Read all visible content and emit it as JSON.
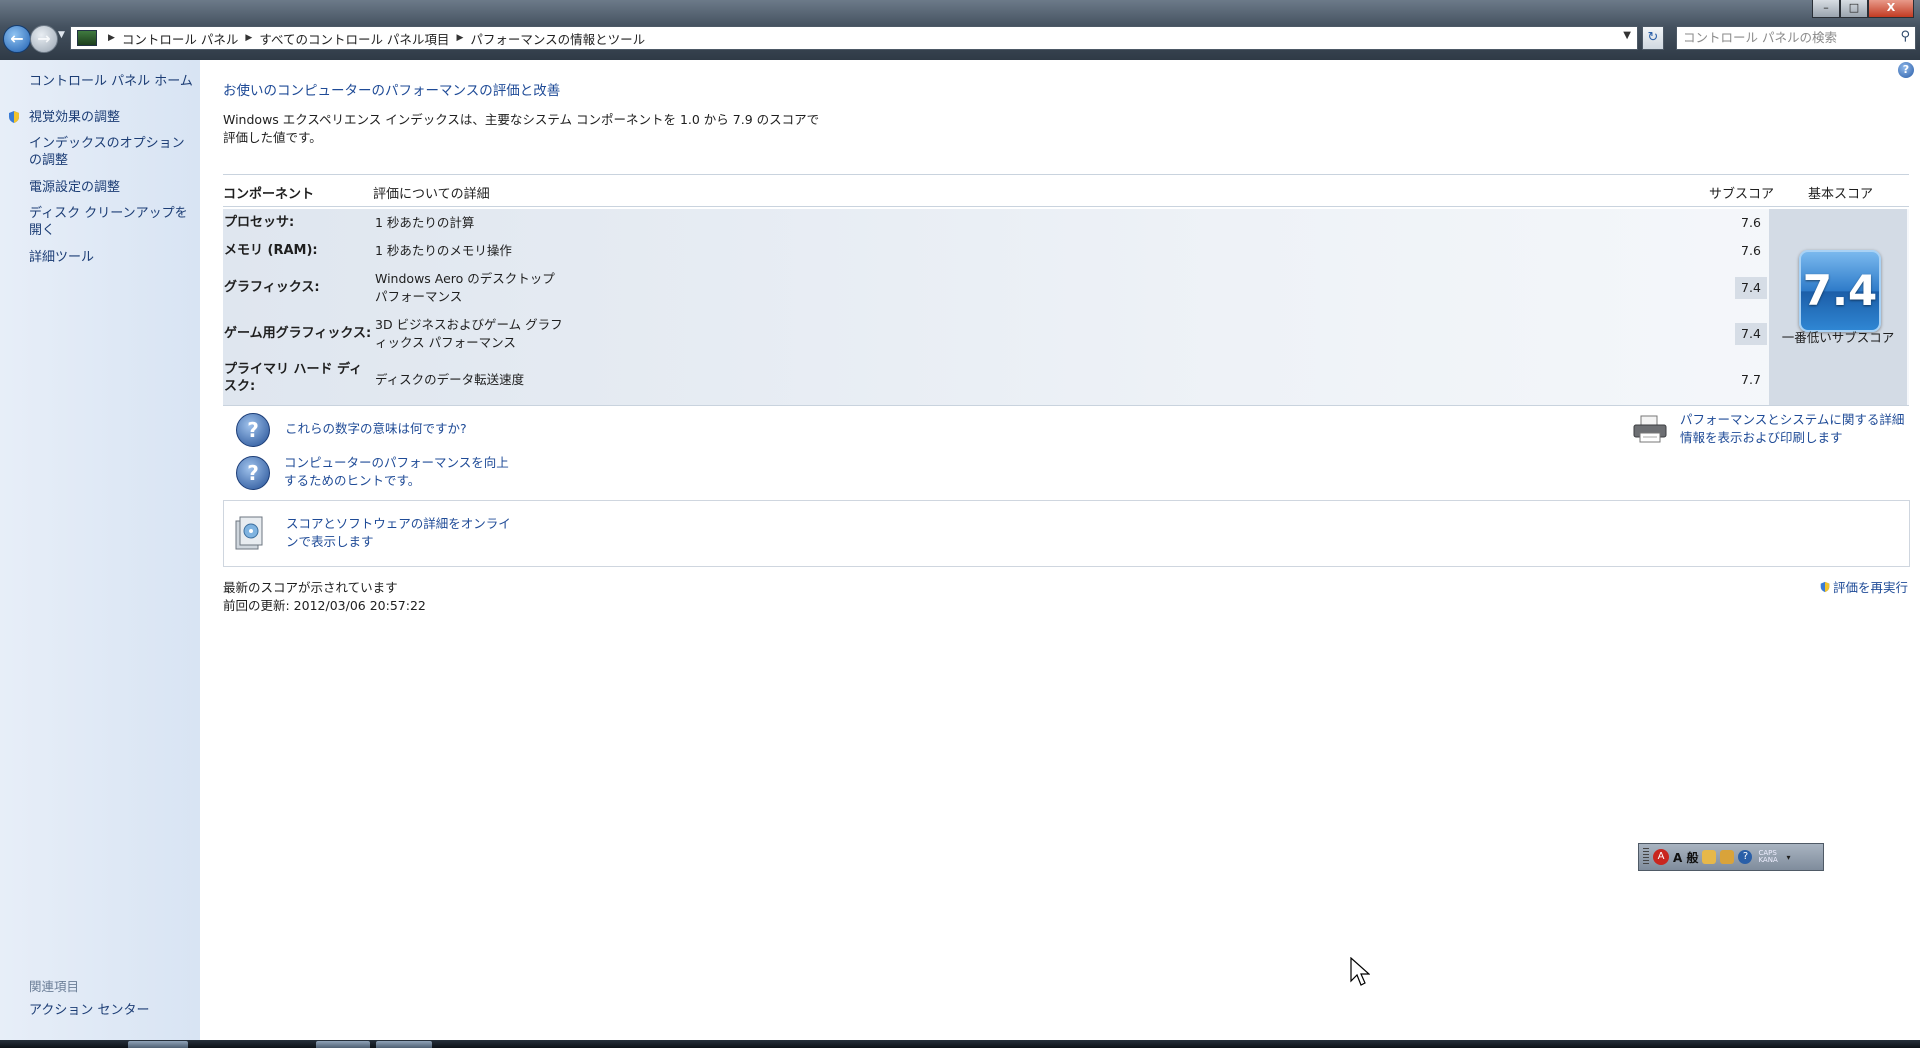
{
  "window": {
    "minimize_label": "–",
    "maximize_label": "□",
    "close_label": "X"
  },
  "address": {
    "crumbs": [
      "コントロール パネル",
      "すべてのコントロール パネル項目",
      "パフォーマンスの情報とツール"
    ]
  },
  "search": {
    "placeholder": "コントロール パネルの検索"
  },
  "sidebar": {
    "home": "コントロール パネル ホーム",
    "items": [
      "視覚効果の調整",
      "インデックスのオプションの調整",
      "電源設定の調整",
      "ディスク クリーンアップを開く",
      "詳細ツール"
    ],
    "related_heading": "関連項目",
    "related_items": [
      "アクション センター"
    ]
  },
  "main": {
    "title": "お使いのコンピューターのパフォーマンスの評価と改善",
    "intro": "Windows エクスペリエンス インデックスは、主要なシステム コンポーネントを 1.0 から 7.9 のスコアで評価した値です。",
    "table": {
      "headers": {
        "component": "コンポーネント",
        "detail": "評価についての詳細",
        "subscore": "サブスコア",
        "basescore": "基本スコア"
      },
      "rows": [
        {
          "name": "プロセッサ:",
          "detail": "1 秒あたりの計算",
          "score": "7.6"
        },
        {
          "name": "メモリ (RAM):",
          "detail": "1 秒あたりのメモリ操作",
          "score": "7.6"
        },
        {
          "name": "グラフィックス:",
          "detail": "Windows Aero のデスクトップ パフォーマンス",
          "score": "7.4"
        },
        {
          "name": "ゲーム用グラフィックス:",
          "detail": "3D ビジネスおよびゲーム グラフィックス パフォーマンス",
          "score": "7.4"
        },
        {
          "name": "プライマリ ハード ディスク:",
          "detail": "ディスクのデータ転送速度",
          "score": "7.7"
        }
      ],
      "base_score": "7.4",
      "base_label": "一番低いサブスコア"
    },
    "links": {
      "meaning": "これらの数字の意味は何ですか?",
      "tips": "コンピューターのパフォーマンスを向上するためのヒントです。",
      "print": "パフォーマンスとシステムに関する詳細情報を表示および印刷します",
      "online": "スコアとソフトウェアの詳細をオンラインで表示します",
      "rerun": "評価を再実行"
    },
    "status": {
      "latest": "最新のスコアが示されています",
      "updated": "前回の更新: 2012/03/06 20:57:22"
    }
  },
  "ime": {
    "mode_label": "A 般",
    "caps_label": "CAPS",
    "kana_label": "KANA"
  },
  "colors": {
    "link": "#1f4b97",
    "sidebar_bg": "#dfe8f5",
    "accent": "#2e7bc9"
  }
}
